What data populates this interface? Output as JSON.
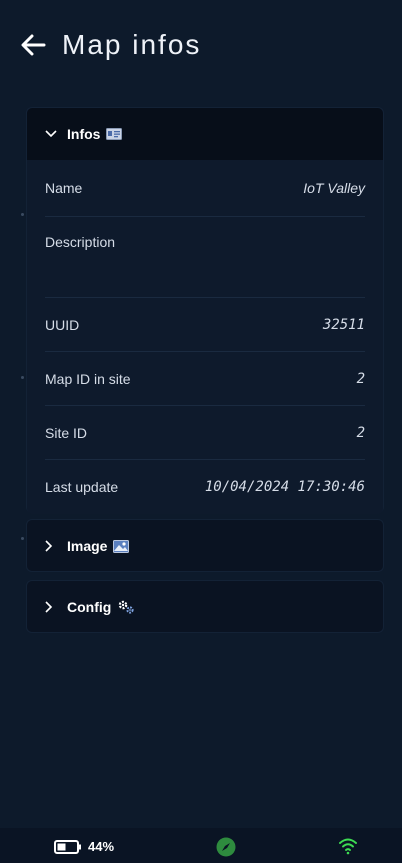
{
  "header": {
    "title": "Map infos",
    "back_icon": "arrow-left-icon"
  },
  "infos": {
    "title": "Infos",
    "icon": "id-card-icon",
    "expanded": true,
    "fields": [
      {
        "label": "Name",
        "value": "IoT Valley"
      },
      {
        "label": "Description",
        "value": ""
      },
      {
        "label": "UUID",
        "value": "32511"
      },
      {
        "label": "Map ID in site",
        "value": "2"
      },
      {
        "label": "Site ID",
        "value": "2"
      },
      {
        "label": "Last update",
        "value": "10/04/2024 17:30:46"
      }
    ]
  },
  "image_panel": {
    "title": "Image",
    "icon": "image-icon",
    "expanded": false
  },
  "config_panel": {
    "title": "Config",
    "icon": "gears-icon",
    "expanded": false
  },
  "statusbar": {
    "battery_percent": "44%",
    "battery_level": 0.44,
    "compass_icon": "compass-icon",
    "wifi_icon": "wifi-icon",
    "colors": {
      "compass": "#2e8b3e",
      "wifi": "#3ddc52"
    }
  }
}
